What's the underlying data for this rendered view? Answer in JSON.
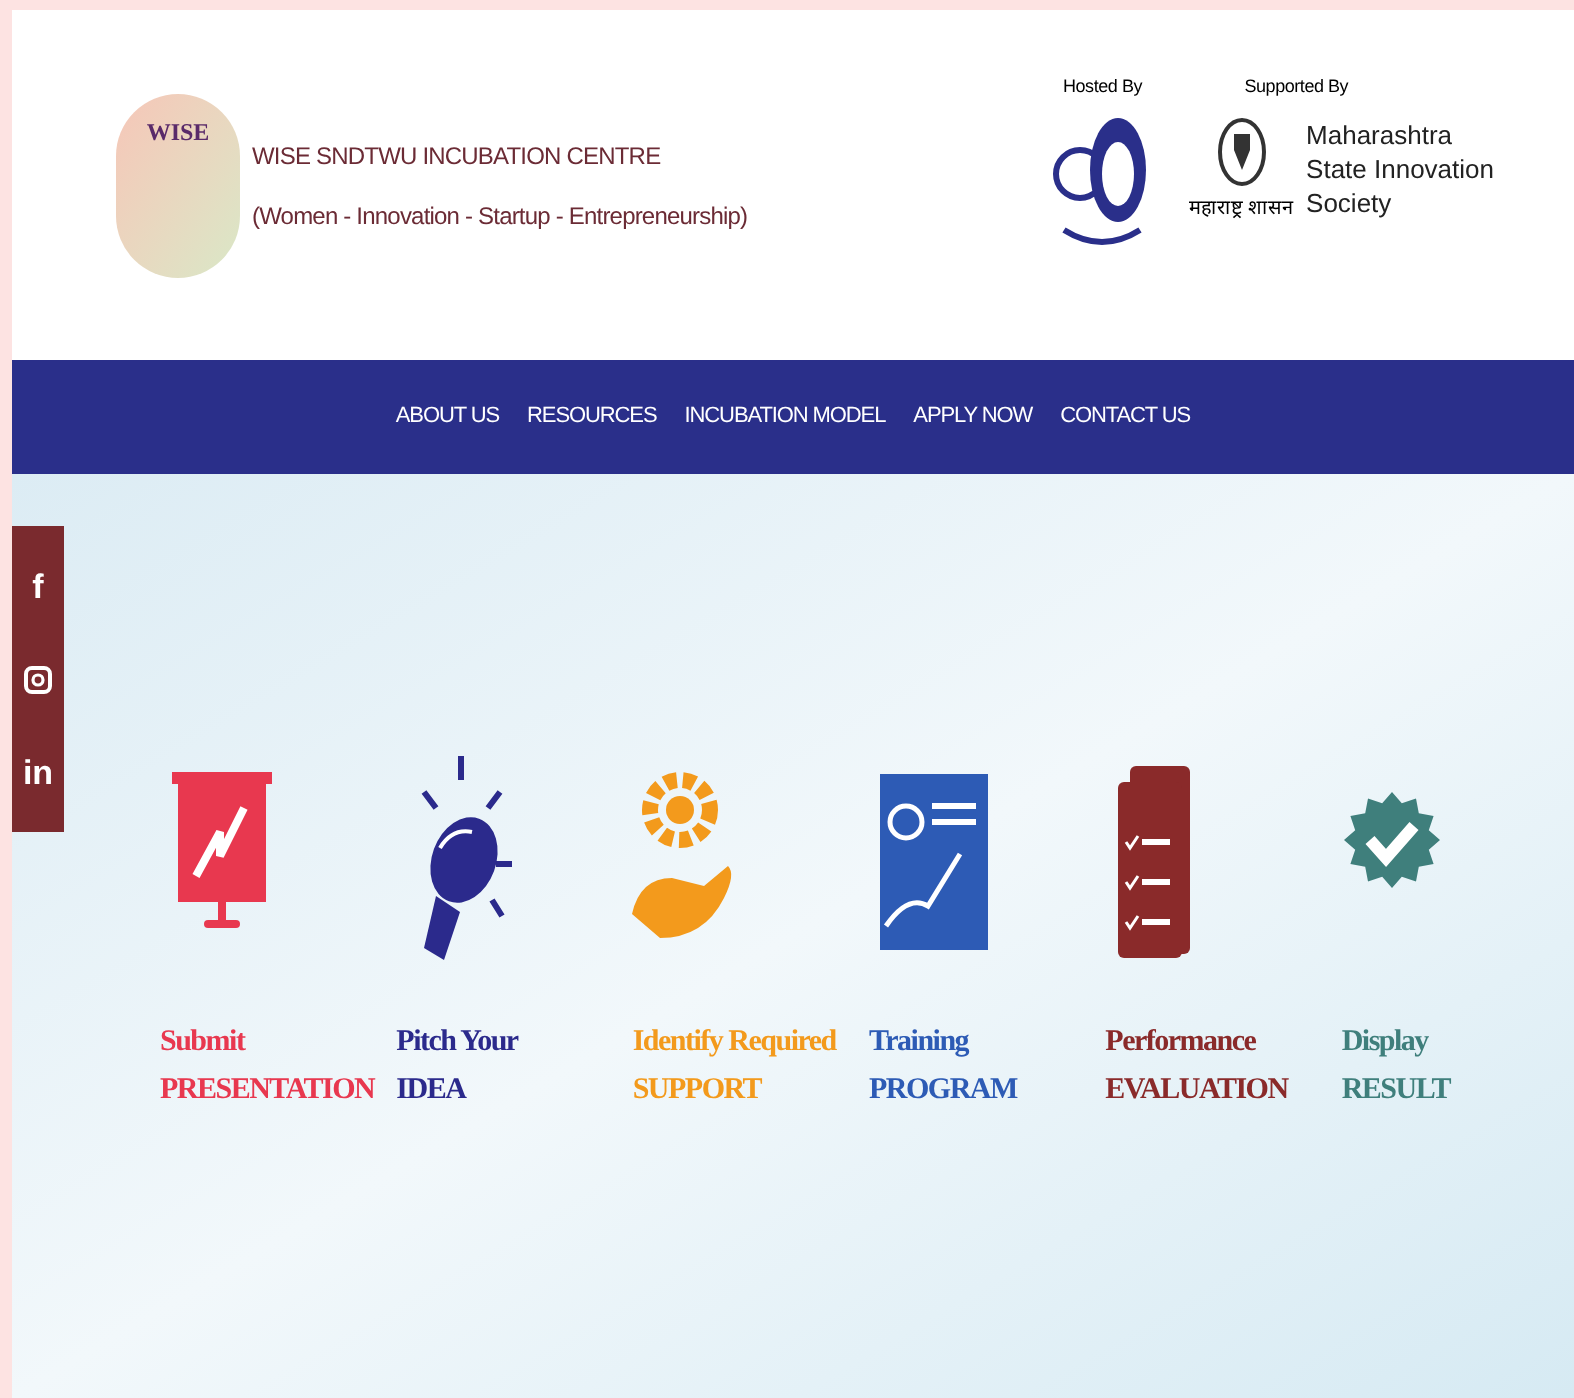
{
  "header": {
    "logo_text": "WISE",
    "title": "WISE SNDTWU INCUBATION CENTRE",
    "subtitle": "(Women - Innovation - Startup - Entrepreneurship)",
    "hosted_by": "Hosted By",
    "supported_by": "Supported By",
    "gov_caption": "महाराष्ट्र शासन",
    "society_name": [
      "Maharashtra",
      "State Innovation",
      "Society"
    ]
  },
  "nav": [
    "ABOUT US",
    "RESOURCES",
    "INCUBATION MODEL",
    "APPLY NOW",
    "CONTACT US"
  ],
  "social": [
    {
      "kind": "facebook",
      "glyph": "f"
    },
    {
      "kind": "instagram"
    },
    {
      "kind": "linkedin",
      "glyph": "in"
    }
  ],
  "steps": [
    {
      "kind": "presentation",
      "color": "#e8384f",
      "line1": "Submit",
      "line2": "PRESENTATION"
    },
    {
      "kind": "bulb",
      "color": "#2b2a8c",
      "line1": "Pitch Your",
      "line2": "IDEA"
    },
    {
      "kind": "gear-hand",
      "color": "#f39a1c",
      "line1": "Identify Required",
      "line2": "SUPPORT"
    },
    {
      "kind": "teacher",
      "color": "#2d5bb5",
      "line1": "Training",
      "line2": "PROGRAM"
    },
    {
      "kind": "checklist",
      "color": "#8a2a2a",
      "line1": "Performance",
      "line2": "EVALUATION"
    },
    {
      "kind": "badge",
      "color": "#3f7f7c",
      "line1": "Display",
      "line2": "RESULT"
    }
  ]
}
